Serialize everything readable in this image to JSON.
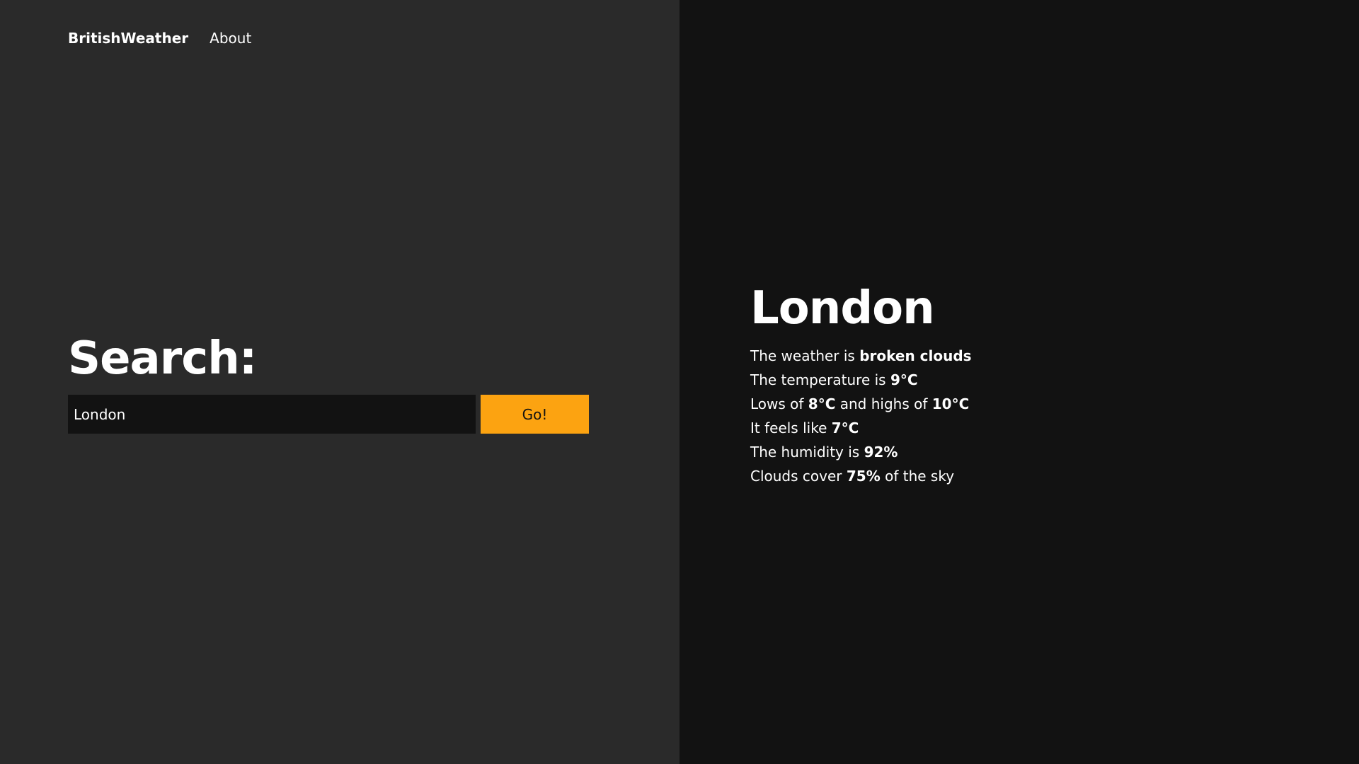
{
  "nav": {
    "brand": "BritishWeather",
    "about": "About"
  },
  "search": {
    "title": "Search:",
    "value": "London",
    "button": "Go!"
  },
  "colors": {
    "left_bg": "#2a2a2a",
    "right_bg": "#121212",
    "accent": "#fca311"
  },
  "result": {
    "city": "London",
    "weather": {
      "prefix": "The weather is ",
      "value": "broken clouds"
    },
    "temperature": {
      "prefix": "The temperature is ",
      "value": "9°C"
    },
    "range": {
      "prefix": "Lows of ",
      "low": "8°C",
      "middle": " and highs of ",
      "high": "10°C"
    },
    "feels": {
      "prefix": "It feels like ",
      "value": "7°C"
    },
    "humidity": {
      "prefix": "The humidity is ",
      "value": "92%"
    },
    "clouds": {
      "prefix": "Clouds cover ",
      "value": "75%",
      "suffix": " of the sky"
    }
  }
}
